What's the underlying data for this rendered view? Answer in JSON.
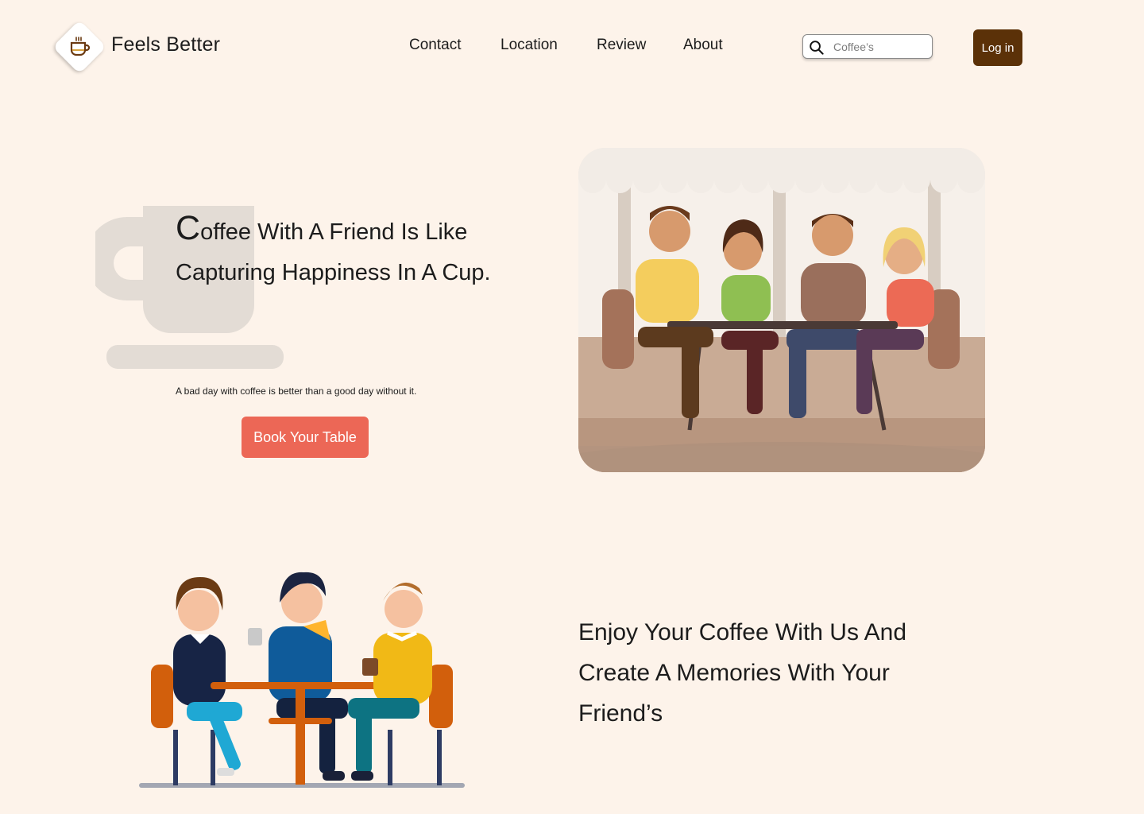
{
  "header": {
    "brand": "Feels Better",
    "nav": [
      {
        "label": "Contact"
      },
      {
        "label": "Location"
      },
      {
        "label": "Review"
      },
      {
        "label": "About"
      }
    ],
    "search": {
      "placeholder": "Coffee’s"
    },
    "login_label": "Log in"
  },
  "hero": {
    "title_initial": "C",
    "title_rest": "offee With A Friend Is Like Capturing Happiness In A Cup.",
    "tagline": "A bad day with coffee is better than a good day without it.",
    "cta_label": "Book Your Table"
  },
  "feature": {
    "text": "Enjoy Your Coffee With Us And Create A Memories With Your Friend’s"
  },
  "colors": {
    "background": "#fdf3ea",
    "login_button": "#5b3108",
    "cta_button": "#ec6756",
    "cup_watermark": "#e3dcd5"
  },
  "icons": {
    "logo": "coffee-cup-icon",
    "search": "search-icon"
  }
}
